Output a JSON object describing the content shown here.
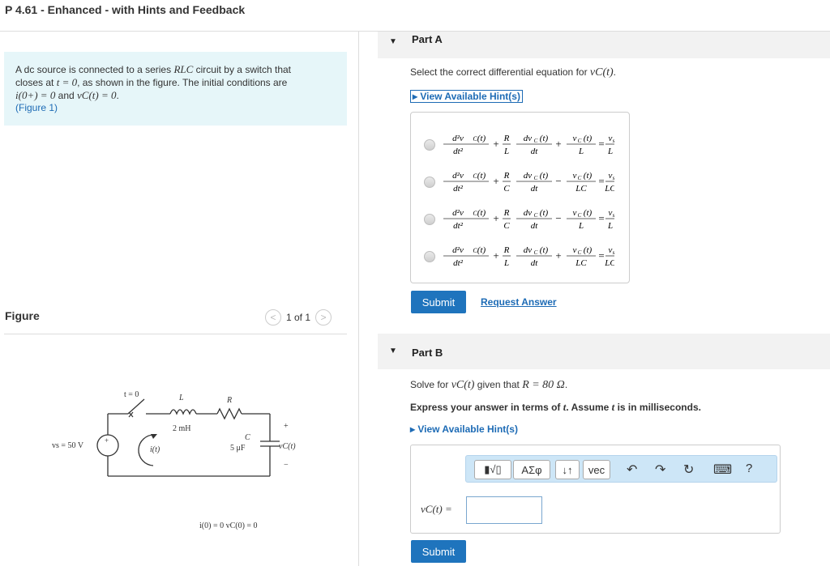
{
  "header": {
    "title": "P 4.61 - Enhanced - with Hints and Feedback"
  },
  "problem": {
    "line1_pre": "A dc source is connected to a series ",
    "line1_math": "RLC",
    "line1_post": " circuit by a switch that",
    "line2_pre": "closes at ",
    "line2_math": "t = 0",
    "line2_post": ", as shown in the figure. The initial conditions are",
    "line3_math1": "i(0+) = 0",
    "line3_mid": " and ",
    "line3_math2": "vC(t) = 0",
    "line3_end": ".",
    "figure_link": "(Figure 1)"
  },
  "figure": {
    "heading": "Figure",
    "pager_prev": "<",
    "pager_count": "1 of 1",
    "pager_next": ">",
    "circuit_labels": {
      "switch": "t = 0",
      "inductor": "L",
      "inductor_value": "2 mH",
      "resistor": "R",
      "capacitor": "C",
      "capacitor_value": "5 μF",
      "source": "vs = 50 V",
      "current": "i(t)",
      "cap_voltage": "vC(t)",
      "plus": "+",
      "minus": "−",
      "src_plus": "+",
      "init": "i(0) = 0    vC(0) = 0"
    }
  },
  "partA": {
    "label": "Part A",
    "prompt_pre": "Select the correct differential equation for ",
    "prompt_math": "vC(t)",
    "prompt_post": ".",
    "hint": "View Available Hint(s)",
    "choices": [
      {
        "coef1": "R",
        "coef1_den": "L",
        "sign2": "+",
        "term3_den": "L",
        "rhs_den": "L"
      },
      {
        "coef1": "R",
        "coef1_den": "C",
        "sign2": "−",
        "term3_den": "LC",
        "rhs_den": "LC"
      },
      {
        "coef1": "R",
        "coef1_den": "C",
        "sign2": "−",
        "term3_den": "L",
        "rhs_den": "L"
      },
      {
        "coef1": "R",
        "coef1_den": "L",
        "sign2": "+",
        "term3_den": "LC",
        "rhs_den": "LC"
      }
    ],
    "submit": "Submit",
    "request": "Request Answer"
  },
  "partB": {
    "label": "Part B",
    "prompt_pre": "Solve for ",
    "prompt_math": "vC(t)",
    "prompt_mid": " given that ",
    "prompt_math2": "R = 80 Ω",
    "prompt_post": ".",
    "note_pre": "Express your answer in terms of ",
    "note_math1": "t",
    "note_mid": ". Assume ",
    "note_math2": "t",
    "note_post": " is in milliseconds.",
    "hint": "View Available Hint(s)",
    "toolbar": {
      "templates": "▮√▯",
      "greek": "ΑΣφ",
      "updown": "↓↑",
      "vec": "vec",
      "undo": "↶",
      "redo": "↷",
      "reset": "↻",
      "keyboard": "⌨",
      "help": "?"
    },
    "answer_label": "vC(t) =",
    "answer_value": "",
    "submit": "Submit"
  },
  "colors": {
    "accent": "#1f74bd",
    "link": "#1d6bb5",
    "problem_bg": "#e6f6f9",
    "part_bg": "#f2f2f2"
  }
}
